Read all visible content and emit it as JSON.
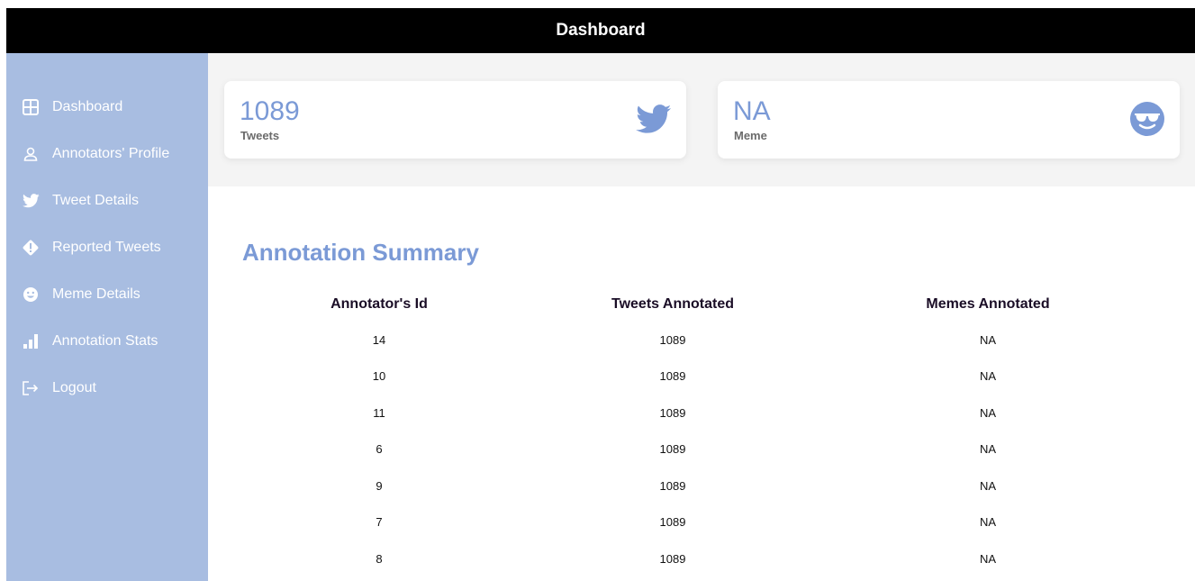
{
  "header": {
    "title": "Dashboard"
  },
  "sidebar": {
    "items": [
      {
        "label": "Dashboard",
        "icon": "grid-icon"
      },
      {
        "label": "Annotators' Profile",
        "icon": "user-icon"
      },
      {
        "label": "Tweet Details",
        "icon": "twitter-icon"
      },
      {
        "label": "Reported Tweets",
        "icon": "alert-diamond-icon"
      },
      {
        "label": "Meme Details",
        "icon": "smiley-icon"
      },
      {
        "label": "Annotation Stats",
        "icon": "bar-chart-icon"
      },
      {
        "label": "Logout",
        "icon": "logout-icon"
      }
    ]
  },
  "cards": [
    {
      "value": "1089",
      "label": "Tweets",
      "icon": "twitter-icon"
    },
    {
      "value": "NA",
      "label": "Meme",
      "icon": "sunglasses-face-icon"
    }
  ],
  "summary": {
    "title": "Annotation Summary",
    "columns": [
      "Annotator's Id",
      "Tweets Annotated",
      "Memes Annotated"
    ],
    "rows": [
      [
        "14",
        "1089",
        "NA"
      ],
      [
        "10",
        "1089",
        "NA"
      ],
      [
        "11",
        "1089",
        "NA"
      ],
      [
        "6",
        "1089",
        "NA"
      ],
      [
        "9",
        "1089",
        "NA"
      ],
      [
        "7",
        "1089",
        "NA"
      ],
      [
        "8",
        "1089",
        "NA"
      ]
    ]
  },
  "colors": {
    "accent": "#7b9ad6",
    "sidebar": "#a8bde1",
    "topbar": "#000000"
  }
}
